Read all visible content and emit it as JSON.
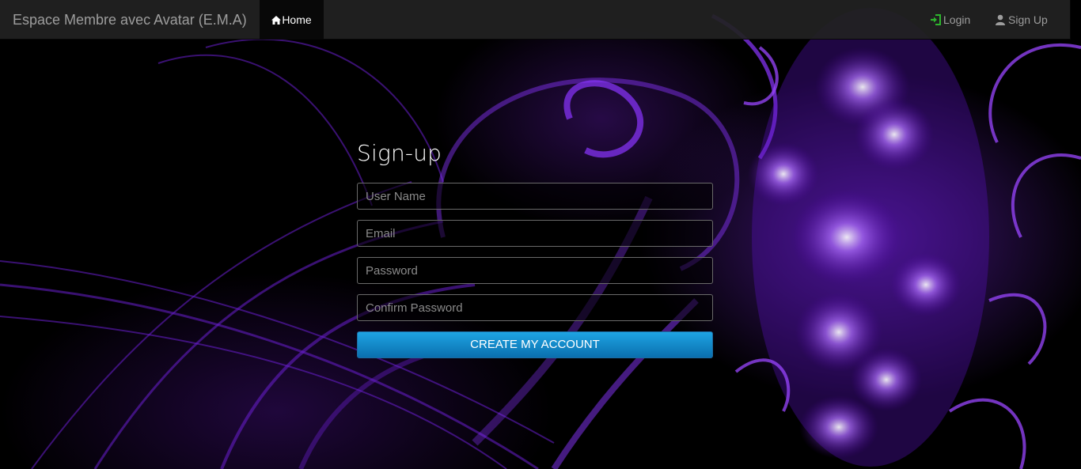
{
  "navbar": {
    "brand": "Espace Membre avec Avatar (E.M.A)",
    "home_label": "Home",
    "home_icon": "home-icon",
    "login_label": "Login",
    "login_icon": "login-icon",
    "signup_label": "Sign Up",
    "signup_icon": "user-icon",
    "login_icon_color": "#2db52d",
    "text_color": "#9d9d9d"
  },
  "form": {
    "title": "Sign-up",
    "fields": [
      {
        "placeholder": "User Name",
        "value": ""
      },
      {
        "placeholder": "Email",
        "value": ""
      },
      {
        "placeholder": "Password",
        "value": ""
      },
      {
        "placeholder": "Confirm Password",
        "value": ""
      }
    ],
    "submit_label": "CREATE MY ACCOUNT",
    "submit_color": "#1591d0"
  },
  "background": {
    "theme": "purple fractal swirls on black",
    "accent": "#8a2be2"
  }
}
